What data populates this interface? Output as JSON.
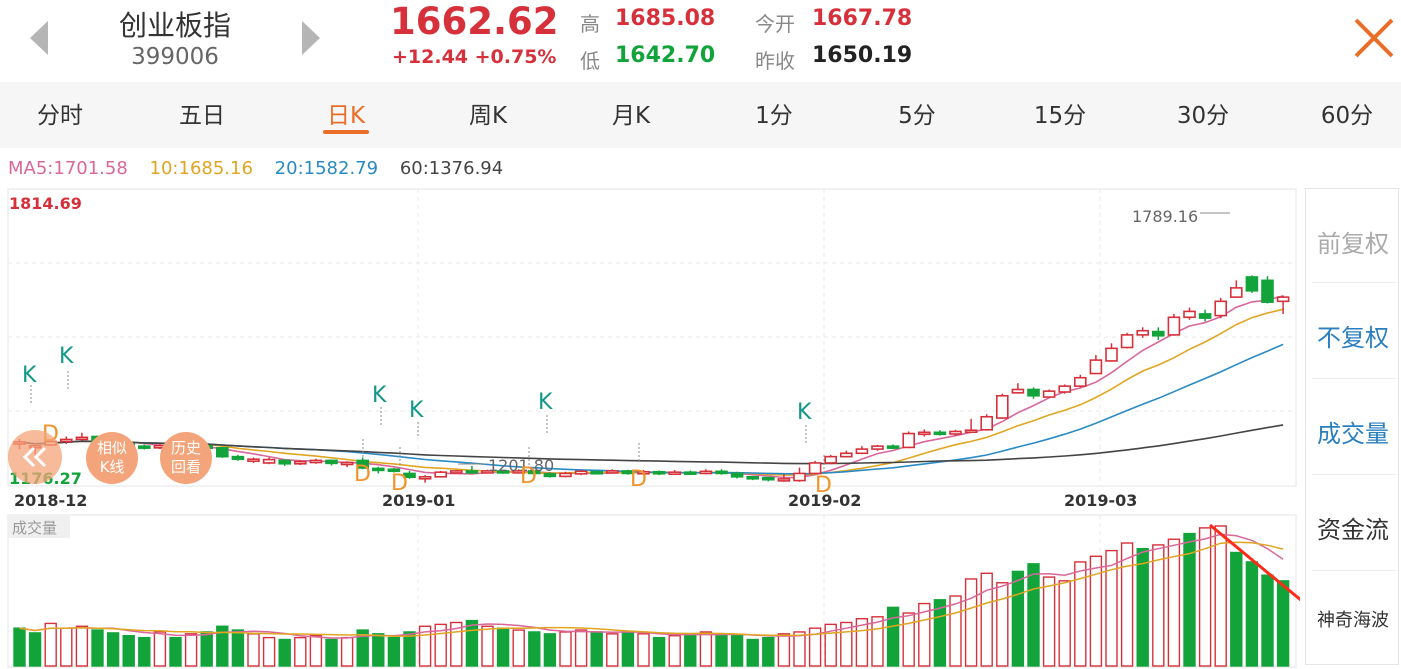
{
  "header": {
    "index_name": "创业板指",
    "index_code": "399006",
    "price": "1662.62",
    "change": "+12.44  +0.75%",
    "high_label": "高",
    "high": "1685.08",
    "low_label": "低",
    "low": "1642.70",
    "open_label": "今开",
    "open": "1667.78",
    "prev_close_label": "昨收",
    "prev_close": "1650.19"
  },
  "tabs": [
    "分时",
    "五日",
    "日K",
    "周K",
    "月K",
    "1分",
    "5分",
    "15分",
    "30分",
    "60分"
  ],
  "active_tab": 2,
  "ma_legend": {
    "ma5": "MA5:1701.58",
    "ma10": "10:1685.16",
    "ma20": "20:1582.79",
    "ma60": "60:1376.94"
  },
  "chart": {
    "y_top_label": "1814.69",
    "y_bottom_label": "1176.27",
    "max_annot": "1789.16",
    "min_annot": "1201.80",
    "dates": [
      "2018-12",
      "2019-01",
      "2019-02",
      "2019-03"
    ],
    "volume_title": "成交量",
    "signal_k": "K",
    "signal_d": "D"
  },
  "buttons": {
    "similar_k": [
      "相似",
      "K线"
    ],
    "history": [
      "历史",
      "回看"
    ]
  },
  "side": {
    "pre_adjust": "前复权",
    "no_adjust": "不复权",
    "volume": "成交量",
    "fund_flow": "资金流",
    "wave": "神奇海波"
  },
  "colors": {
    "up": "#d6313b",
    "down": "#12a43b",
    "accent": "#ea6d28",
    "ma5": "#d9679b",
    "ma10": "#e0a521",
    "ma20": "#2a8bc4",
    "ma60": "#444444"
  },
  "chart_data": {
    "type": "candlestick",
    "ylim": [
      1176.27,
      1814.69
    ],
    "candles": [
      [
        1250,
        1255,
        1238,
        1262
      ],
      [
        1243,
        1246,
        1225,
        1252
      ],
      [
        1248,
        1256,
        1246,
        1262
      ],
      [
        1256,
        1261,
        1250,
        1268
      ],
      [
        1262,
        1266,
        1258,
        1277
      ],
      [
        1268,
        1254,
        1250,
        1270
      ],
      [
        1254,
        1250,
        1243,
        1258
      ],
      [
        1250,
        1245,
        1240,
        1254
      ],
      [
        1245,
        1241,
        1237,
        1249
      ],
      [
        1241,
        1246,
        1238,
        1251
      ],
      [
        1246,
        1243,
        1239,
        1250
      ],
      [
        1243,
        1246,
        1240,
        1252
      ],
      [
        1246,
        1240,
        1236,
        1251
      ],
      [
        1241,
        1220,
        1217,
        1243
      ],
      [
        1220,
        1214,
        1210,
        1224
      ],
      [
        1210,
        1214,
        1205,
        1218
      ],
      [
        1205,
        1213,
        1202,
        1218
      ],
      [
        1211,
        1203,
        1198,
        1214
      ],
      [
        1203,
        1208,
        1200,
        1212
      ],
      [
        1206,
        1211,
        1203,
        1215
      ],
      [
        1211,
        1204,
        1199,
        1213
      ],
      [
        1203,
        1206,
        1195,
        1209
      ],
      [
        1211,
        1193,
        1190,
        1218
      ],
      [
        1192,
        1190,
        1180,
        1196
      ],
      [
        1190,
        1186,
        1182,
        1193
      ],
      [
        1180,
        1171,
        1167,
        1186
      ],
      [
        1168,
        1172,
        1158,
        1176
      ],
      [
        1172,
        1183,
        1172,
        1186
      ],
      [
        1183,
        1186,
        1179,
        1188
      ],
      [
        1186,
        1183,
        1180,
        1198
      ],
      [
        1183,
        1186,
        1180,
        1189
      ],
      [
        1186,
        1183,
        1179,
        1187
      ],
      [
        1183,
        1186,
        1180,
        1190
      ],
      [
        1186,
        1180,
        1177,
        1188
      ],
      [
        1179,
        1173,
        1170,
        1183
      ],
      [
        1173,
        1180,
        1171,
        1184
      ],
      [
        1179,
        1185,
        1176,
        1189
      ],
      [
        1184,
        1182,
        1178,
        1187
      ],
      [
        1182,
        1186,
        1180,
        1190
      ],
      [
        1186,
        1180,
        1177,
        1189
      ],
      [
        1180,
        1184,
        1178,
        1188
      ],
      [
        1184,
        1180,
        1176,
        1187
      ],
      [
        1180,
        1183,
        1177,
        1188
      ],
      [
        1183,
        1180,
        1176,
        1187
      ],
      [
        1180,
        1185,
        1178,
        1190
      ],
      [
        1185,
        1180,
        1177,
        1190
      ],
      [
        1180,
        1172,
        1168,
        1184
      ],
      [
        1172,
        1168,
        1164,
        1174
      ],
      [
        1170,
        1165,
        1161,
        1172
      ],
      [
        1165,
        1167,
        1160,
        1178
      ],
      [
        1163,
        1180,
        1160,
        1194
      ],
      [
        1180,
        1205,
        1180,
        1210
      ],
      [
        1205,
        1220,
        1202,
        1224
      ],
      [
        1220,
        1228,
        1218,
        1234
      ],
      [
        1228,
        1238,
        1226,
        1245
      ],
      [
        1238,
        1245,
        1234,
        1248
      ],
      [
        1245,
        1242,
        1238,
        1249
      ],
      [
        1242,
        1275,
        1240,
        1280
      ],
      [
        1275,
        1278,
        1268,
        1285
      ],
      [
        1278,
        1274,
        1270,
        1283
      ],
      [
        1274,
        1280,
        1270,
        1284
      ],
      [
        1280,
        1283,
        1278,
        1310
      ],
      [
        1284,
        1315,
        1282,
        1321
      ],
      [
        1312,
        1365,
        1310,
        1370
      ],
      [
        1372,
        1380,
        1370,
        1395
      ],
      [
        1380,
        1365,
        1358,
        1385
      ],
      [
        1362,
        1376,
        1362,
        1380
      ],
      [
        1374,
        1388,
        1370,
        1392
      ],
      [
        1388,
        1408,
        1385,
        1415
      ],
      [
        1418,
        1450,
        1418,
        1462
      ],
      [
        1448,
        1478,
        1448,
        1490
      ],
      [
        1480,
        1510,
        1478,
        1515
      ],
      [
        1510,
        1520,
        1503,
        1528
      ],
      [
        1518,
        1508,
        1498,
        1528
      ],
      [
        1510,
        1552,
        1508,
        1560
      ],
      [
        1552,
        1566,
        1546,
        1575
      ],
      [
        1560,
        1550,
        1542,
        1570
      ],
      [
        1556,
        1590,
        1550,
        1598
      ],
      [
        1600,
        1622,
        1598,
        1640
      ],
      [
        1648,
        1615,
        1610,
        1652
      ],
      [
        1640,
        1588,
        1585,
        1650
      ],
      [
        1590,
        1600,
        1560,
        1604
      ]
    ],
    "volume_up": [
      0,
      0,
      1,
      1,
      1,
      0,
      0,
      0,
      0,
      1,
      0,
      1,
      0,
      0,
      0,
      1,
      1,
      0,
      1,
      1,
      0,
      1,
      0,
      0,
      0,
      0,
      1,
      1,
      1,
      0,
      1,
      0,
      1,
      0,
      0,
      1,
      1,
      0,
      1,
      0,
      1,
      0,
      1,
      0,
      1,
      0,
      0,
      0,
      0,
      1,
      1,
      1,
      1,
      1,
      1,
      1,
      0,
      1,
      1,
      0,
      1,
      1,
      1,
      1,
      0,
      0,
      1,
      1,
      1,
      1,
      1,
      1,
      0,
      1,
      1,
      0,
      1,
      1,
      0,
      0,
      0,
      0
    ],
    "volume": [
      40,
      35,
      45,
      40,
      42,
      38,
      35,
      32,
      30,
      36,
      30,
      34,
      36,
      42,
      38,
      34,
      30,
      28,
      30,
      32,
      28,
      30,
      38,
      34,
      30,
      36,
      42,
      44,
      46,
      48,
      42,
      40,
      38,
      36,
      34,
      36,
      38,
      36,
      34,
      36,
      34,
      30,
      32,
      34,
      36,
      34,
      32,
      28,
      30,
      34,
      36,
      40,
      44,
      46,
      50,
      52,
      62,
      56,
      66,
      70,
      74,
      92,
      98,
      88,
      100,
      108,
      94,
      90,
      110,
      116,
      122,
      130,
      124,
      128,
      134,
      140,
      146,
      148,
      120,
      110,
      96,
      90
    ]
  }
}
